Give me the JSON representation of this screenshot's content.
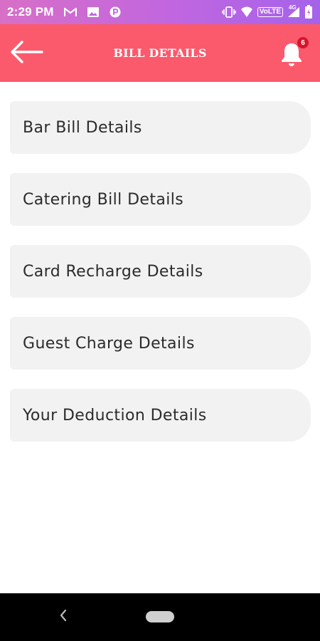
{
  "status_bar": {
    "time": "2:29 PM",
    "left_icons": [
      "gmail-icon",
      "photos-icon",
      "p-app-icon"
    ],
    "right_icons": [
      "vibrate-icon",
      "wifi-icon",
      "volte-icon",
      "signal-icon",
      "battery-icon"
    ],
    "volte_label": "VoLTE",
    "network_label": "4G"
  },
  "app_bar": {
    "title": "BILL DETAILS",
    "notification_count": "6",
    "color": "#fb5a6c"
  },
  "menu": {
    "items": [
      {
        "label": "Bar Bill Details"
      },
      {
        "label": "Catering Bill Details"
      },
      {
        "label": "Card Recharge Details"
      },
      {
        "label": "Guest Charge Details"
      },
      {
        "label": "Your Deduction Details"
      }
    ]
  },
  "colors": {
    "status_bar_start": "#d86fc7",
    "status_bar_end": "#a463ea",
    "card_background": "#f2f2f2",
    "badge": "#d6152c"
  }
}
